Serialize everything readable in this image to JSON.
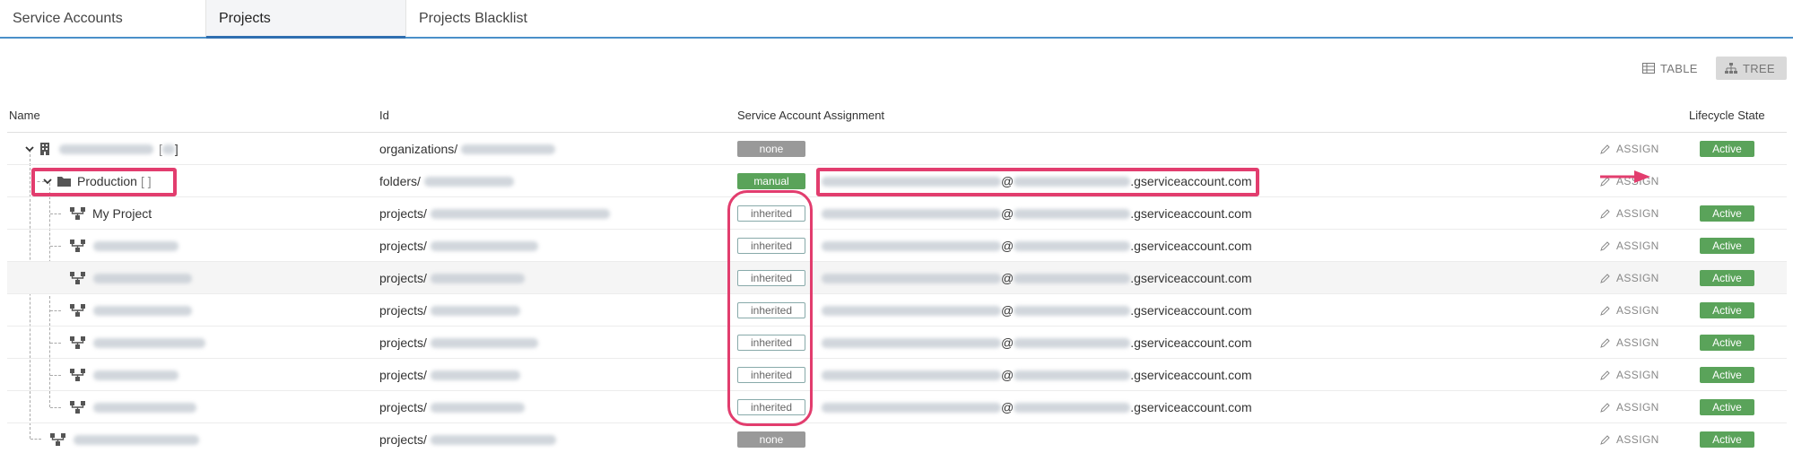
{
  "tabs": [
    {
      "label": "Service Accounts"
    },
    {
      "label": "Projects"
    },
    {
      "label": "Projects Blacklist"
    }
  ],
  "view_toggle": {
    "table_label": "TABLE",
    "tree_label": "TREE",
    "selected": "tree"
  },
  "columns": {
    "name": "Name",
    "id": "Id",
    "assignment": "Service Account Assignment",
    "lifecycle": "Lifecycle State"
  },
  "assign_label": "ASSIGN",
  "active_label": "Active",
  "email_domain_suffix": ".gserviceaccount.com",
  "at_sign": "@",
  "rows": [
    {
      "name_visible": "",
      "name_suffix": "]",
      "id_prefix": "organizations/",
      "badge": "none",
      "has_email": false,
      "lifecycle": "Active"
    },
    {
      "name_visible": "Production",
      "name_suffix": "[  ]",
      "id_prefix": "folders/",
      "badge": "manual",
      "has_email": true,
      "lifecycle": ""
    },
    {
      "name_visible": "My Project",
      "name_suffix": "",
      "id_prefix": "projects/",
      "badge": "inherited",
      "has_email": true,
      "lifecycle": "Active"
    },
    {
      "name_visible": "",
      "name_suffix": "",
      "id_prefix": "projects/",
      "badge": "inherited",
      "has_email": true,
      "lifecycle": "Active"
    },
    {
      "name_visible": "",
      "name_suffix": "",
      "id_prefix": "projects/",
      "badge": "inherited",
      "has_email": true,
      "lifecycle": "Active"
    },
    {
      "name_visible": "",
      "name_suffix": "",
      "id_prefix": "projects/",
      "badge": "inherited",
      "has_email": true,
      "lifecycle": "Active"
    },
    {
      "name_visible": "",
      "name_suffix": "",
      "id_prefix": "projects/",
      "badge": "inherited",
      "has_email": true,
      "lifecycle": "Active"
    },
    {
      "name_visible": "",
      "name_suffix": "",
      "id_prefix": "projects/",
      "badge": "inherited",
      "has_email": true,
      "lifecycle": "Active"
    },
    {
      "name_visible": "",
      "name_suffix": "",
      "id_prefix": "projects/",
      "badge": "inherited",
      "has_email": true,
      "lifecycle": "Active"
    },
    {
      "name_visible": "",
      "name_suffix": "",
      "id_prefix": "projects/",
      "badge": "none",
      "has_email": false,
      "lifecycle": "Active"
    }
  ],
  "colors": {
    "accent": "#2f6fb0",
    "active": "#5aa35a",
    "annotation": "#e23d6e"
  }
}
